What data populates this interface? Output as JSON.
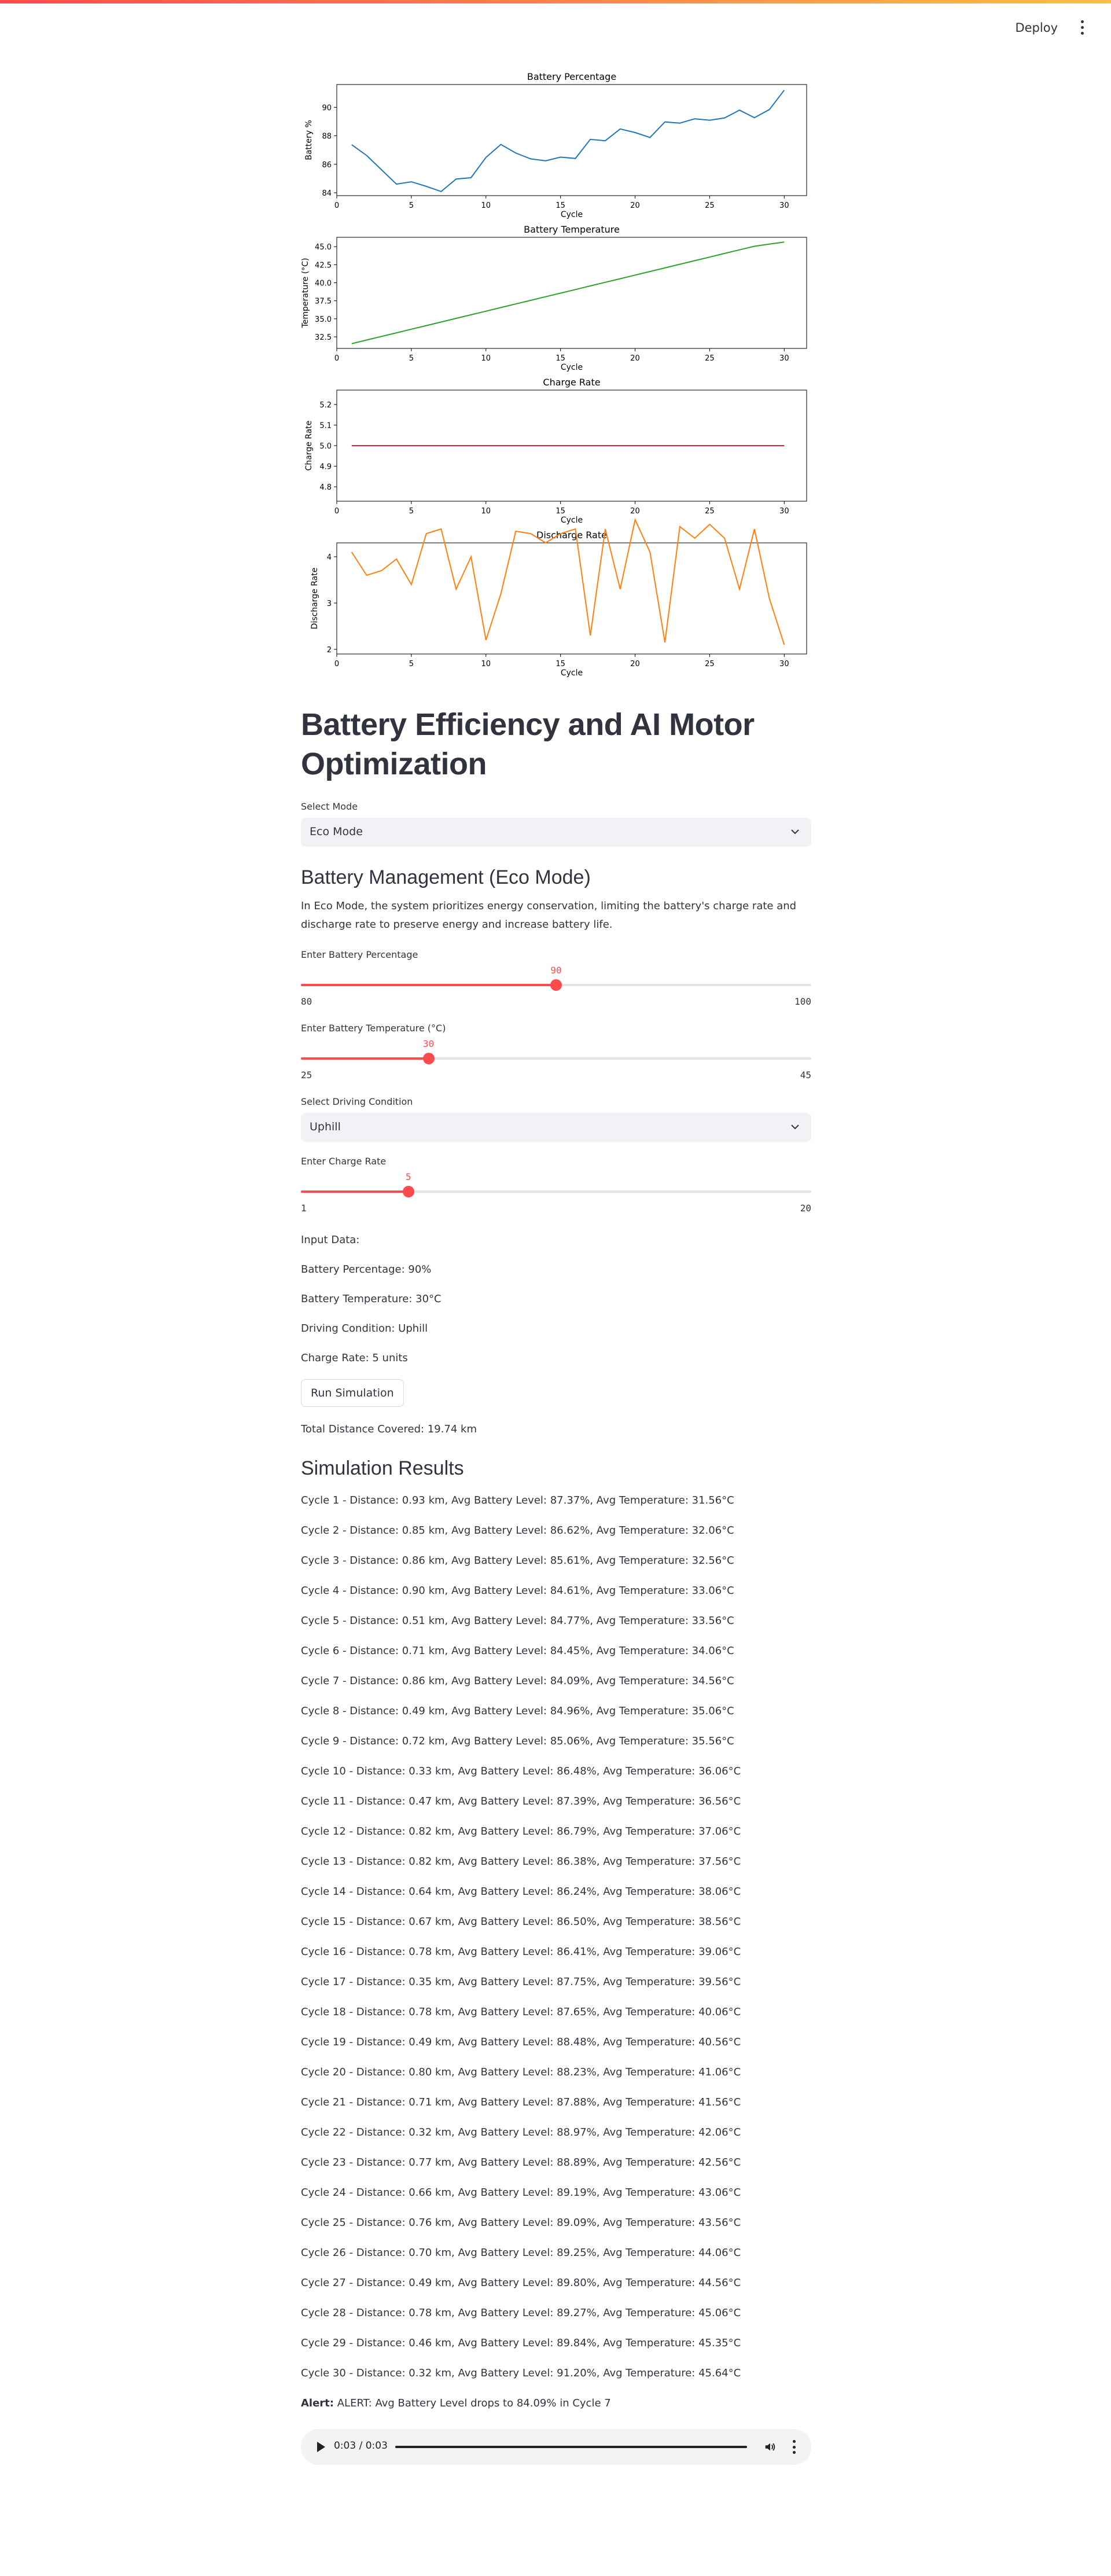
{
  "header": {
    "deploy_label": "Deploy",
    "menu_icon": "kebab-menu-icon"
  },
  "chart_data": [
    {
      "type": "line",
      "title": "Battery Percentage",
      "xlabel": "Cycle",
      "ylabel": "Battery %",
      "color": "#1f77b4",
      "xlim": [
        0,
        31.5
      ],
      "ylim": [
        83.8,
        91.6
      ],
      "xticks": [
        0,
        5,
        10,
        15,
        20,
        25,
        30
      ],
      "yticks": [
        84,
        86,
        88,
        90
      ],
      "ytick_labels": [
        "84",
        "86",
        "88",
        "90"
      ],
      "x": [
        1,
        2,
        3,
        4,
        5,
        6,
        7,
        8,
        9,
        10,
        11,
        12,
        13,
        14,
        15,
        16,
        17,
        18,
        19,
        20,
        21,
        22,
        23,
        24,
        25,
        26,
        27,
        28,
        29,
        30
      ],
      "values": [
        87.37,
        86.62,
        85.61,
        84.61,
        84.77,
        84.45,
        84.09,
        84.96,
        85.06,
        86.48,
        87.39,
        86.79,
        86.38,
        86.24,
        86.5,
        86.41,
        87.75,
        87.65,
        88.48,
        88.23,
        87.88,
        88.97,
        88.89,
        89.19,
        89.09,
        89.25,
        89.8,
        89.27,
        89.84,
        91.2
      ]
    },
    {
      "type": "line",
      "title": "Battery Temperature",
      "xlabel": "Cycle",
      "ylabel": "Temperature (°C)",
      "color": "#2ca02c",
      "xlim": [
        0,
        31.5
      ],
      "ylim": [
        30.9,
        46.3
      ],
      "xticks": [
        0,
        5,
        10,
        15,
        20,
        25,
        30
      ],
      "yticks": [
        32.5,
        35.0,
        37.5,
        40.0,
        42.5,
        45.0
      ],
      "ytick_labels": [
        "32.5",
        "35.0",
        "37.5",
        "40.0",
        "42.5",
        "45.0"
      ],
      "x": [
        1,
        2,
        3,
        4,
        5,
        6,
        7,
        8,
        9,
        10,
        11,
        12,
        13,
        14,
        15,
        16,
        17,
        18,
        19,
        20,
        21,
        22,
        23,
        24,
        25,
        26,
        27,
        28,
        29,
        30
      ],
      "values": [
        31.56,
        32.06,
        32.56,
        33.06,
        33.56,
        34.06,
        34.56,
        35.06,
        35.56,
        36.06,
        36.56,
        37.06,
        37.56,
        38.06,
        38.56,
        39.06,
        39.56,
        40.06,
        40.56,
        41.06,
        41.56,
        42.06,
        42.56,
        43.06,
        43.56,
        44.06,
        44.56,
        45.06,
        45.35,
        45.64
      ]
    },
    {
      "type": "line",
      "title": "Charge Rate",
      "xlabel": "Cycle",
      "ylabel": "Charge Rate",
      "color": "#d62728",
      "xlim": [
        0,
        31.5
      ],
      "ylim": [
        4.73,
        5.27
      ],
      "xticks": [
        0,
        5,
        10,
        15,
        20,
        25,
        30
      ],
      "yticks": [
        4.8,
        4.9,
        5.0,
        5.1,
        5.2
      ],
      "ytick_labels": [
        "4.8",
        "4.9",
        "5.0",
        "5.1",
        "5.2"
      ],
      "x": [
        1,
        30
      ],
      "values": [
        5,
        5
      ]
    },
    {
      "type": "line",
      "title": "Discharge Rate",
      "xlabel": "Cycle",
      "ylabel": "Discharge Rate",
      "color": "#ff7f0e",
      "xlim": [
        0,
        31.5
      ],
      "ylim": [
        1.9,
        4.3
      ],
      "xticks": [
        0,
        5,
        10,
        15,
        20,
        25,
        30
      ],
      "yticks": [
        2,
        3,
        4
      ],
      "ytick_labels": [
        "2",
        "3",
        "4"
      ],
      "x": [
        1,
        2,
        3,
        4,
        5,
        6,
        7,
        8,
        9,
        10,
        11,
        12,
        13,
        14,
        15,
        16,
        17,
        18,
        19,
        20,
        21,
        22,
        23,
        24,
        25,
        26,
        27,
        28,
        29,
        30
      ],
      "values": [
        4.1,
        3.6,
        3.7,
        3.95,
        3.4,
        4.5,
        4.6,
        3.3,
        4.0,
        2.2,
        3.2,
        4.55,
        4.5,
        4.3,
        4.5,
        4.6,
        2.3,
        4.6,
        3.3,
        4.8,
        4.1,
        2.15,
        4.65,
        4.4,
        4.7,
        4.4,
        3.3,
        4.6,
        3.1,
        2.1
      ]
    }
  ],
  "title": "Battery Efficiency and AI Motor Optimization",
  "mode": {
    "label": "Select Mode",
    "value": "Eco Mode"
  },
  "section": {
    "heading": "Battery Management (Eco Mode)",
    "description": "In Eco Mode, the system prioritizes energy conservation, limiting the battery's charge rate and discharge rate to preserve energy and increase battery life."
  },
  "sliders": [
    {
      "label": "Enter Battery Percentage",
      "value": 90,
      "min": 80,
      "max": 100
    },
    {
      "label": "Enter Battery Temperature (°C)",
      "value": 30,
      "min": 25,
      "max": 45
    },
    {
      "label": "Enter Charge Rate",
      "value": 5,
      "min": 1,
      "max": 20
    }
  ],
  "driving": {
    "label": "Select Driving Condition",
    "value": "Uphill"
  },
  "input_data": {
    "heading": "Input Data:",
    "battery_percentage": "Battery Percentage: 90%",
    "battery_temperature": "Battery Temperature: 30°C",
    "driving_condition": "Driving Condition: Uphill",
    "charge_rate": "Charge Rate: 5 units"
  },
  "run_button": "Run Simulation",
  "total_distance": "Total Distance Covered: 19.74 km",
  "results": {
    "heading": "Simulation Results",
    "cycles": [
      "Cycle 1 - Distance: 0.93 km, Avg Battery Level: 87.37%, Avg Temperature: 31.56°C",
      "Cycle 2 - Distance: 0.85 km, Avg Battery Level: 86.62%, Avg Temperature: 32.06°C",
      "Cycle 3 - Distance: 0.86 km, Avg Battery Level: 85.61%, Avg Temperature: 32.56°C",
      "Cycle 4 - Distance: 0.90 km, Avg Battery Level: 84.61%, Avg Temperature: 33.06°C",
      "Cycle 5 - Distance: 0.51 km, Avg Battery Level: 84.77%, Avg Temperature: 33.56°C",
      "Cycle 6 - Distance: 0.71 km, Avg Battery Level: 84.45%, Avg Temperature: 34.06°C",
      "Cycle 7 - Distance: 0.86 km, Avg Battery Level: 84.09%, Avg Temperature: 34.56°C",
      "Cycle 8 - Distance: 0.49 km, Avg Battery Level: 84.96%, Avg Temperature: 35.06°C",
      "Cycle 9 - Distance: 0.72 km, Avg Battery Level: 85.06%, Avg Temperature: 35.56°C",
      "Cycle 10 - Distance: 0.33 km, Avg Battery Level: 86.48%, Avg Temperature: 36.06°C",
      "Cycle 11 - Distance: 0.47 km, Avg Battery Level: 87.39%, Avg Temperature: 36.56°C",
      "Cycle 12 - Distance: 0.82 km, Avg Battery Level: 86.79%, Avg Temperature: 37.06°C",
      "Cycle 13 - Distance: 0.82 km, Avg Battery Level: 86.38%, Avg Temperature: 37.56°C",
      "Cycle 14 - Distance: 0.64 km, Avg Battery Level: 86.24%, Avg Temperature: 38.06°C",
      "Cycle 15 - Distance: 0.67 km, Avg Battery Level: 86.50%, Avg Temperature: 38.56°C",
      "Cycle 16 - Distance: 0.78 km, Avg Battery Level: 86.41%, Avg Temperature: 39.06°C",
      "Cycle 17 - Distance: 0.35 km, Avg Battery Level: 87.75%, Avg Temperature: 39.56°C",
      "Cycle 18 - Distance: 0.78 km, Avg Battery Level: 87.65%, Avg Temperature: 40.06°C",
      "Cycle 19 - Distance: 0.49 km, Avg Battery Level: 88.48%, Avg Temperature: 40.56°C",
      "Cycle 20 - Distance: 0.80 km, Avg Battery Level: 88.23%, Avg Temperature: 41.06°C",
      "Cycle 21 - Distance: 0.71 km, Avg Battery Level: 87.88%, Avg Temperature: 41.56°C",
      "Cycle 22 - Distance: 0.32 km, Avg Battery Level: 88.97%, Avg Temperature: 42.06°C",
      "Cycle 23 - Distance: 0.77 km, Avg Battery Level: 88.89%, Avg Temperature: 42.56°C",
      "Cycle 24 - Distance: 0.66 km, Avg Battery Level: 89.19%, Avg Temperature: 43.06°C",
      "Cycle 25 - Distance: 0.76 km, Avg Battery Level: 89.09%, Avg Temperature: 43.56°C",
      "Cycle 26 - Distance: 0.70 km, Avg Battery Level: 89.25%, Avg Temperature: 44.06°C",
      "Cycle 27 - Distance: 0.49 km, Avg Battery Level: 89.80%, Avg Temperature: 44.56°C",
      "Cycle 28 - Distance: 0.78 km, Avg Battery Level: 89.27%, Avg Temperature: 45.06°C",
      "Cycle 29 - Distance: 0.46 km, Avg Battery Level: 89.84%, Avg Temperature: 45.35°C",
      "Cycle 30 - Distance: 0.32 km, Avg Battery Level: 91.20%, Avg Temperature: 45.64°C"
    ]
  },
  "alert": {
    "label": "Alert:",
    "text": "ALERT: Avg Battery Level drops to 84.09% in Cycle 7"
  },
  "audio": {
    "time": "0:03 / 0:03",
    "play_icon": "play-icon",
    "volume_icon": "volume-icon",
    "more_icon": "more-options-icon"
  }
}
